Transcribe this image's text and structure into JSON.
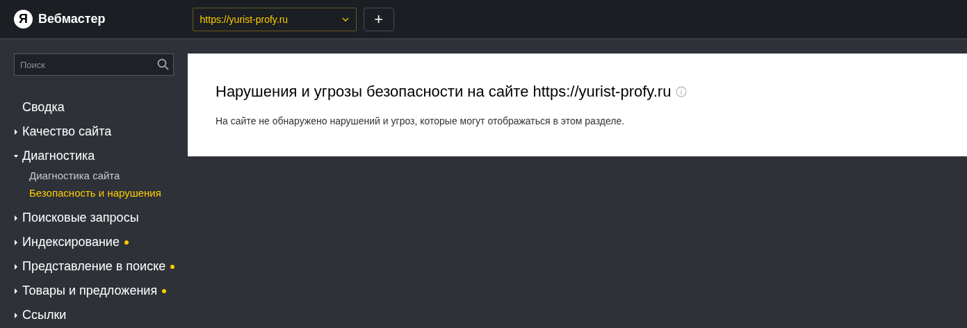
{
  "header": {
    "logo_letter": "Я",
    "app_name": "Вебмастер",
    "site_select": {
      "value": "https://yurist-profy.ru"
    },
    "add_button": "+"
  },
  "sidebar": {
    "search": {
      "placeholder": "Поиск"
    },
    "items": [
      {
        "label": "Сводка",
        "kind": "link",
        "dot": false
      },
      {
        "label": "Качество сайта",
        "kind": "group",
        "expanded": false,
        "dot": false
      },
      {
        "label": "Диагностика",
        "kind": "group",
        "expanded": true,
        "dot": false,
        "children": [
          {
            "label": "Диагностика сайта",
            "selected": false
          },
          {
            "label": "Безопасность и нарушения",
            "selected": true
          }
        ]
      },
      {
        "label": "Поисковые запросы",
        "kind": "group",
        "expanded": false,
        "dot": false
      },
      {
        "label": "Индексирование",
        "kind": "group",
        "expanded": false,
        "dot": true
      },
      {
        "label": "Представление в поиске",
        "kind": "group",
        "expanded": false,
        "dot": true
      },
      {
        "label": "Товары и предложения",
        "kind": "group",
        "expanded": false,
        "dot": true
      },
      {
        "label": "Ссылки",
        "kind": "group",
        "expanded": false,
        "dot": false
      }
    ]
  },
  "content": {
    "title": "Нарушения и угрозы безопасности на сайте https://yurist-profy.ru",
    "message": "На сайте не обнаружено нарушений и угроз, которые могут отображаться в этом разделе."
  }
}
